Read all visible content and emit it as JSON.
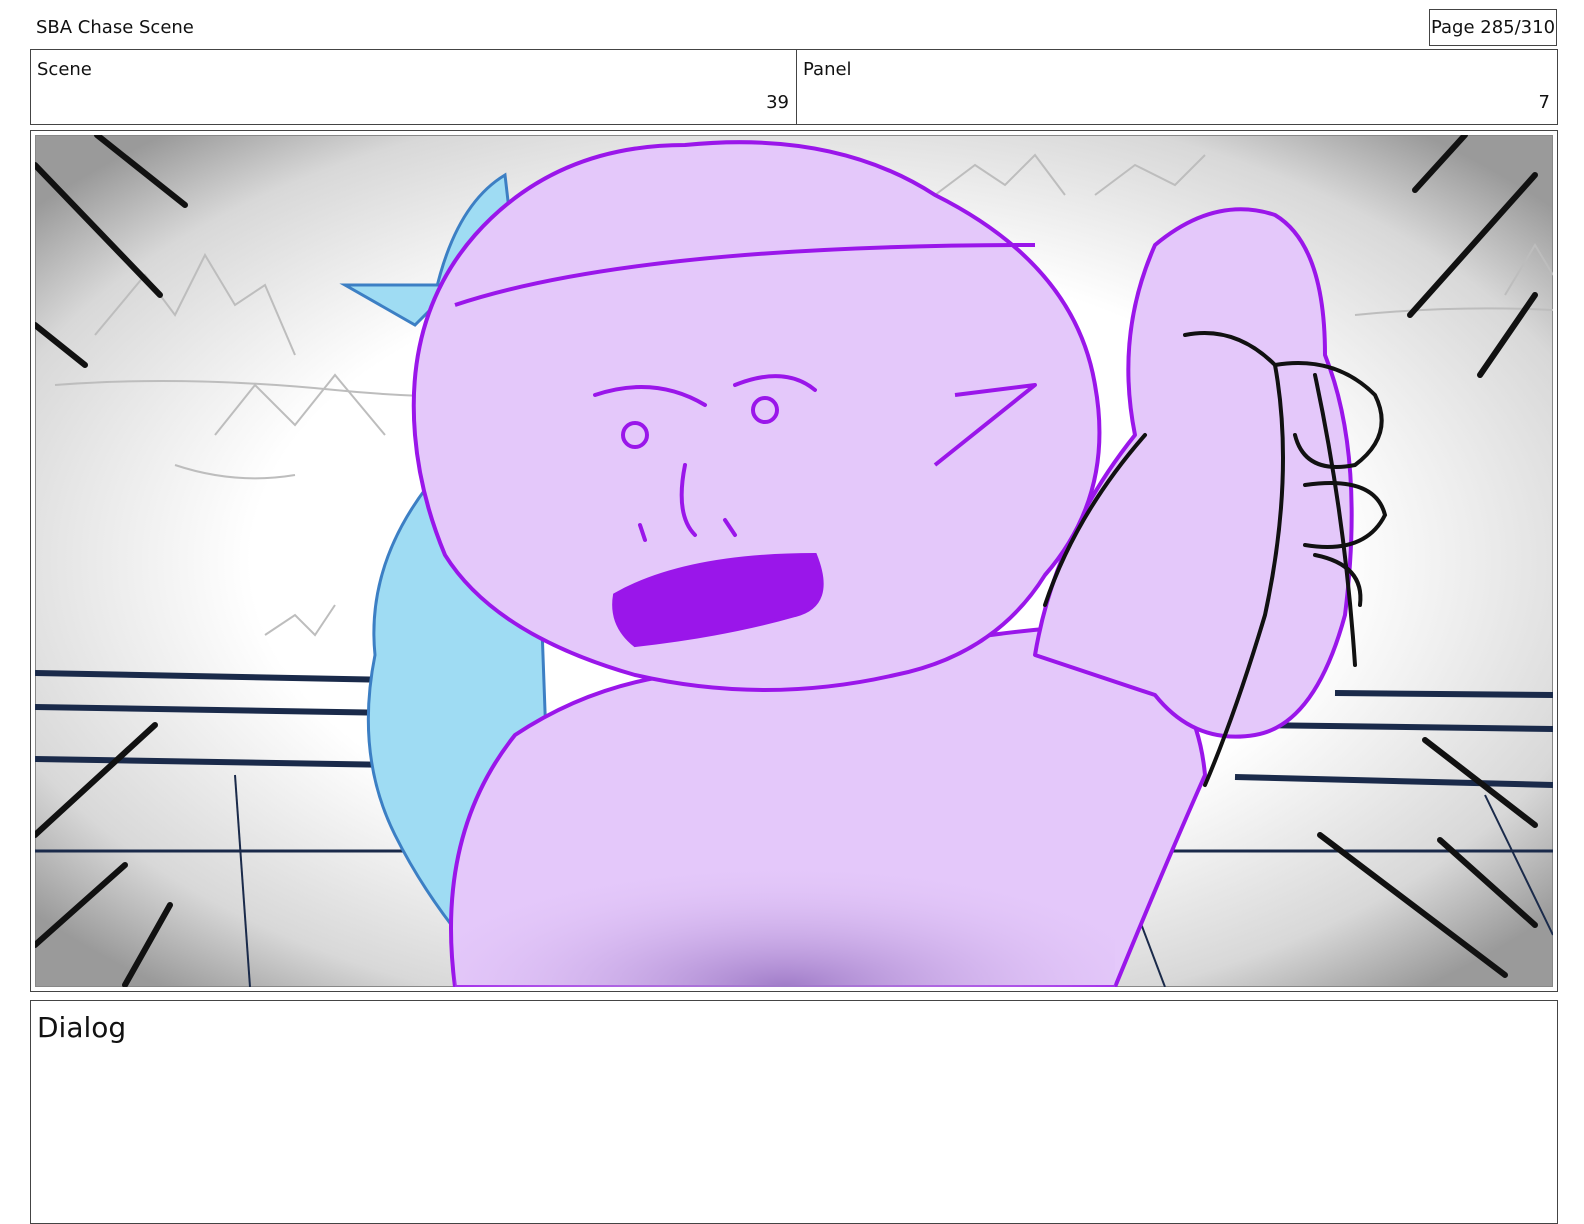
{
  "header": {
    "title": "SBA Chase Scene",
    "page": "Page 285/310"
  },
  "scene": {
    "label": "Scene",
    "value": "39"
  },
  "panel": {
    "label": "Panel",
    "value": "7"
  },
  "artwork": {
    "subject": "storyboard-panel-sketch"
  },
  "dialog": {
    "label": "Dialog",
    "text": ""
  },
  "colors": {
    "purple_fill": "#e4c8fa",
    "purple_line": "#9a16ea",
    "blue_fill": "#9fdcf3",
    "blue_line": "#3c7fc4",
    "rail_line": "#1a2a4a"
  }
}
